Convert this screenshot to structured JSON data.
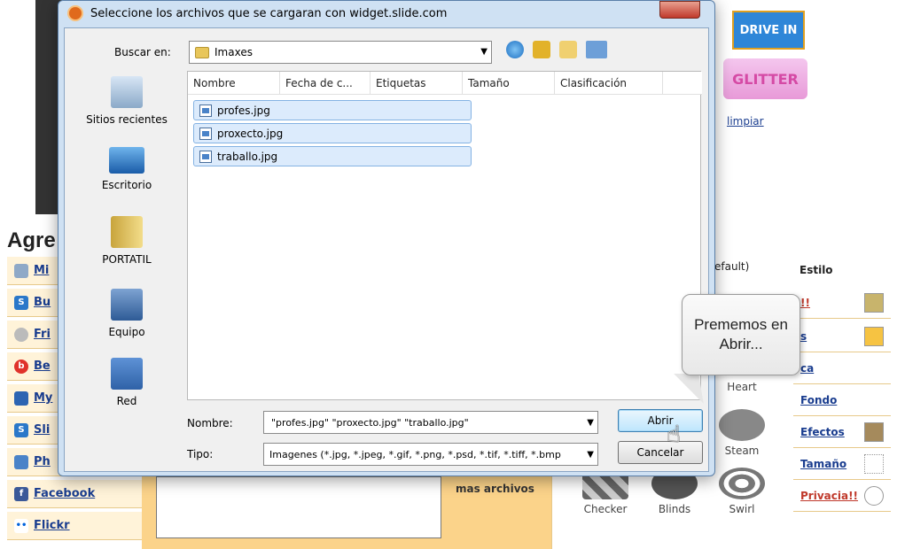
{
  "dialog": {
    "title": "Seleccione los archivos que se cargaran con widget.slide.com",
    "look_in_label": "Buscar en:",
    "look_in_value": "Imaxes",
    "places": [
      "Sitios recientes",
      "Escritorio",
      "PORTATIL",
      "Equipo",
      "Red"
    ],
    "columns": [
      "Nombre",
      "Fecha de c...",
      "Etiquetas",
      "Tamaño",
      "Clasificación"
    ],
    "files": [
      "profes.jpg",
      "proxecto.jpg",
      "traballo.jpg"
    ],
    "name_label": "Nombre:",
    "name_value": "\"profes.jpg\" \"proxecto.jpg\" \"traballo.jpg\"",
    "type_label": "Tipo:",
    "type_value": "Imagenes (*.jpg, *.jpeg, *.gif, *.png, *.psd, *.tif, *.tiff, *.bmp",
    "open_button": "Abrir",
    "cancel_button": "Cancelar"
  },
  "callout": {
    "text": "Prememos en Abrir..."
  },
  "background": {
    "heading": "Agre",
    "left_links": [
      "Mi",
      "Bu",
      "Fri",
      "Be",
      "My",
      "Sli",
      "Ph",
      "Facebook",
      "Flickr"
    ],
    "mas_archivos": "mas archivos",
    "drive_in": "DRIVE IN",
    "glitter": "GLITTER",
    "limpiar": "limpiar",
    "default_label": "efault)",
    "estilo": "Estilo",
    "right_links": [
      "!!",
      "s",
      "ca",
      "Fondo",
      "Efectos",
      "Tamaño",
      "Privacia!!"
    ],
    "effects": [
      "Heart",
      "Steam",
      "Checker",
      "Blinds",
      "Swirl"
    ]
  },
  "colors": {
    "dialog_frame": "#cfe1f3",
    "selection": "#dcebfc",
    "link": "#1a3d8f",
    "panel": "#fbd38a"
  }
}
